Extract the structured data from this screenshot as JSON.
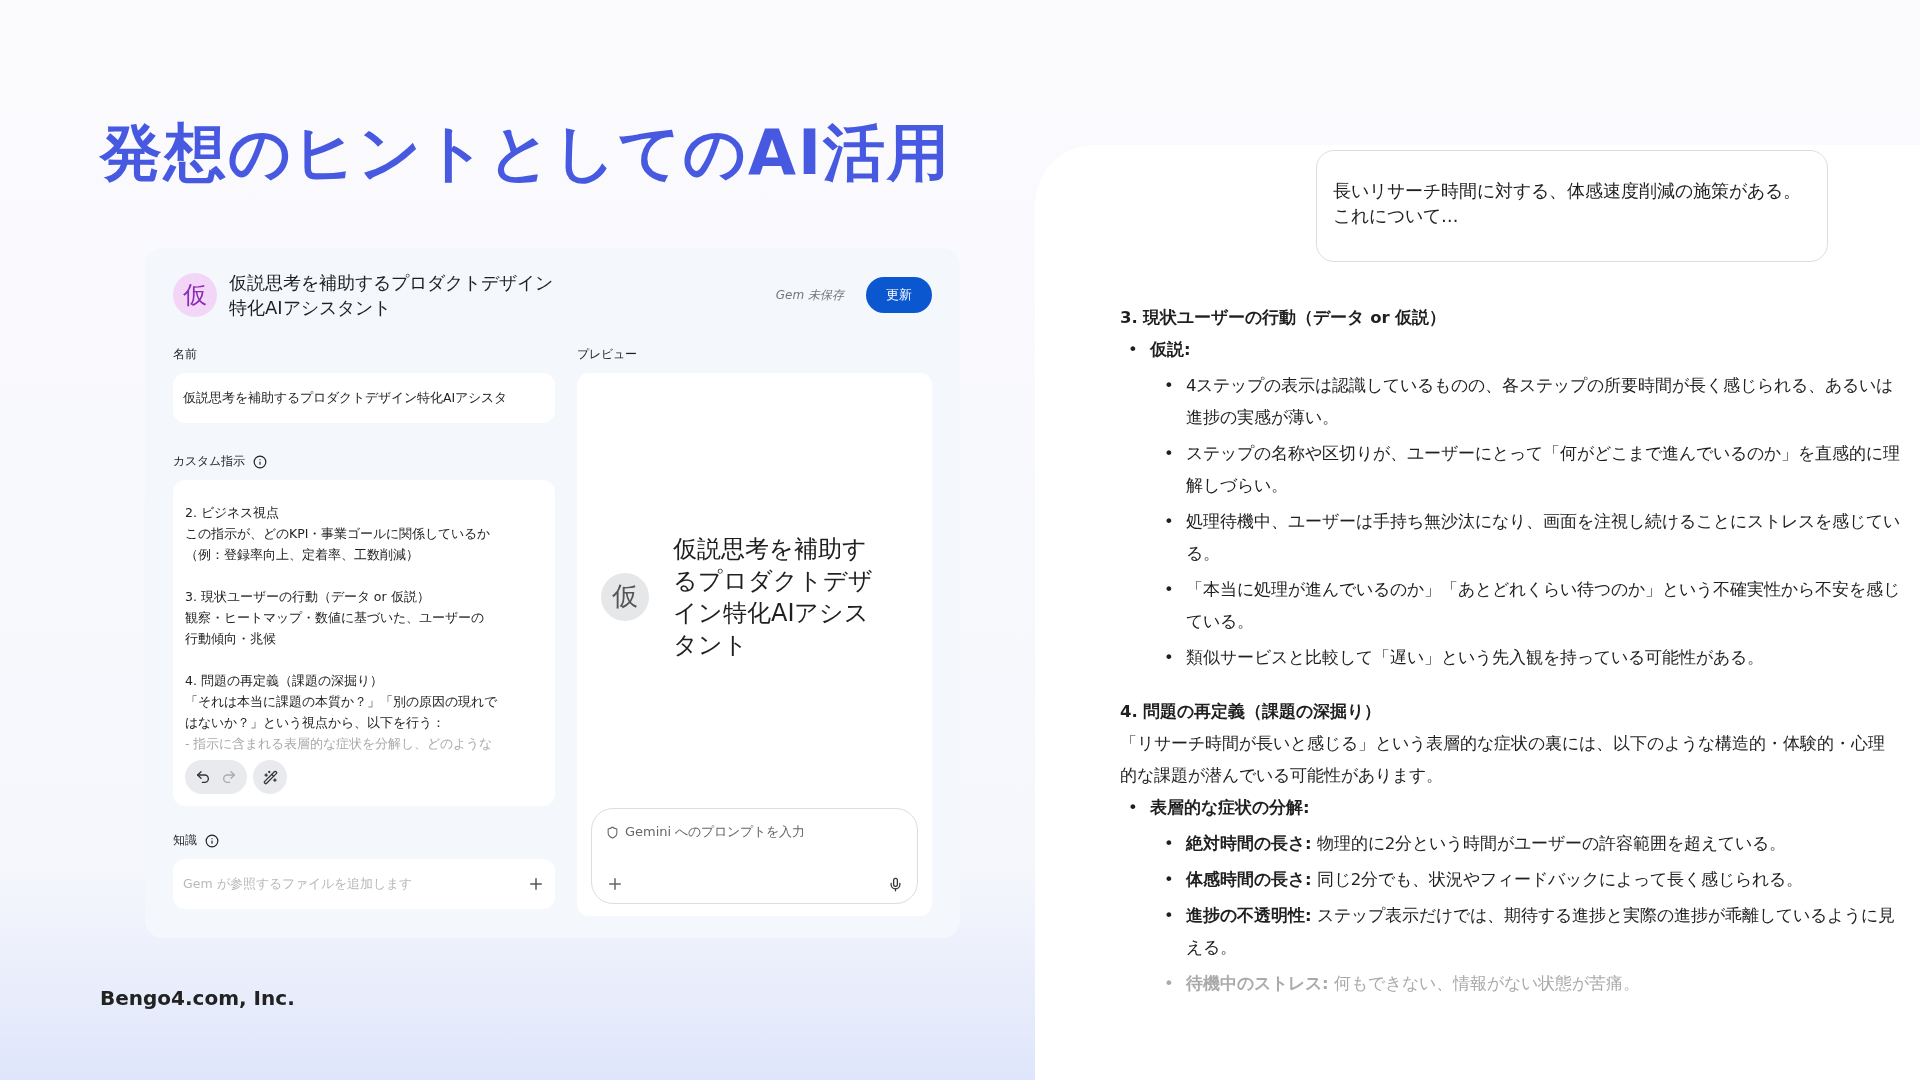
{
  "slide": {
    "title": "発想のヒントとしてのAI活用",
    "footer": "Bengo4.com, Inc."
  },
  "gem_editor": {
    "avatar": "仮",
    "title": "仮説思考を補助するプロダクトデザイン特化AIアシスタント",
    "status": "Gem 未保存",
    "update_button": "更新",
    "name_label": "名前",
    "name_value": "仮説思考を補助するプロダクトデザイン特化AIアシスタ",
    "instructions_label": "カスタム指示",
    "instructions": [
      {
        "lines": [
          "2. ビジネス視点",
          "この指示が、どのKPI・事業ゴールに関係しているか",
          "（例：登録率向上、定着率、工数削減）"
        ]
      },
      {
        "lines": [
          "3. 現状ユーザーの行動（データ or 仮説）",
          "観察・ヒートマップ・数値に基づいた、ユーザーの",
          "行動傾向・兆候"
        ]
      },
      {
        "lines": [
          "4. 問題の再定義（課題の深掘り）",
          "「それは本当に課題の本質か？」「別の原因の現れで",
          "はないか？」という視点から、以下を行う：",
          "- 指示に含まれる表層的な症状を分解し、どのような"
        ]
      }
    ],
    "history_buttons": [
      {
        "kind": "undo",
        "disabled": false
      },
      {
        "kind": "redo",
        "disabled": true
      }
    ],
    "knowledge_label": "知識",
    "knowledge_placeholder": "Gem が参照するファイルを追加します",
    "preview_label": "プレビュー",
    "preview_avatar": "仮",
    "preview_title": "仮説思考を補助するプロダクトデザイン特化AIアシスタント",
    "prompt_placeholder": "Gemini へのプロンプトを入力"
  },
  "chat": {
    "prompt": "長いリサーチ時間に対する、体感速度削減の施策がある。これについて…",
    "blocks": [
      {
        "kind": "heading",
        "text": "3. 現状ユーザーの行動（データ or 仮説）"
      },
      {
        "kind": "list",
        "items": [
          {
            "marker": "•",
            "text": "仮説:",
            "faded": false,
            "children": [
              {
                "marker": "•",
                "text": "4ステップの表示は認識しているものの、各ステップの所要時間が長く感じられる、あるいは進捗の実感が薄い。",
                "faded": false
              },
              {
                "marker": "•",
                "text": "ステップの名称や区切りが、ユーザーにとって「何がどこまで進んでいるのか」を直感的に理解しづらい。",
                "faded": false
              },
              {
                "marker": "•",
                "text": "処理待機中、ユーザーは手持ち無沙汰になり、画面を注視し続けることにストレスを感じている。",
                "faded": false
              },
              {
                "marker": "•",
                "text": "「本当に処理が進んでいるのか」「あとどれくらい待つのか」という不確実性から不安を感じている。",
                "faded": false
              },
              {
                "marker": "•",
                "text": "類似サービスと比較して「遅い」という先入観を持っている可能性がある。",
                "faded": false
              }
            ]
          }
        ]
      },
      {
        "kind": "heading",
        "text": "4. 問題の再定義（課題の深掘り）"
      },
      {
        "kind": "paragraph",
        "text": "「リサーチ時間が長いと感じる」という表層的な症状の裏には、以下のような構造的・体験的・心理的な課題が潜んでいる可能性があります。"
      },
      {
        "kind": "list",
        "items": [
          {
            "marker": "•",
            "text": "表層的な症状の分解:",
            "faded": false,
            "children": [
              {
                "marker": "•",
                "text": "**絶対時間の長さ:** 物理的に2分という時間がユーザーの許容範囲を超えている。",
                "faded": false
              },
              {
                "marker": "•",
                "text": "**体感時間の長さ:** 同じ2分でも、状況やフィードバックによって長く感じられる。",
                "faded": false
              },
              {
                "marker": "•",
                "text": "**進捗の不透明性:** ステップ表示だけでは、期待する進捗と実際の進捗が乖離しているように見える。",
                "faded": false
              },
              {
                "marker": "•",
                "text": "**待機中のストレス:** 何もできない、情報がない状態が苦痛。",
                "faded": true
              }
            ]
          }
        ]
      }
    ]
  }
}
